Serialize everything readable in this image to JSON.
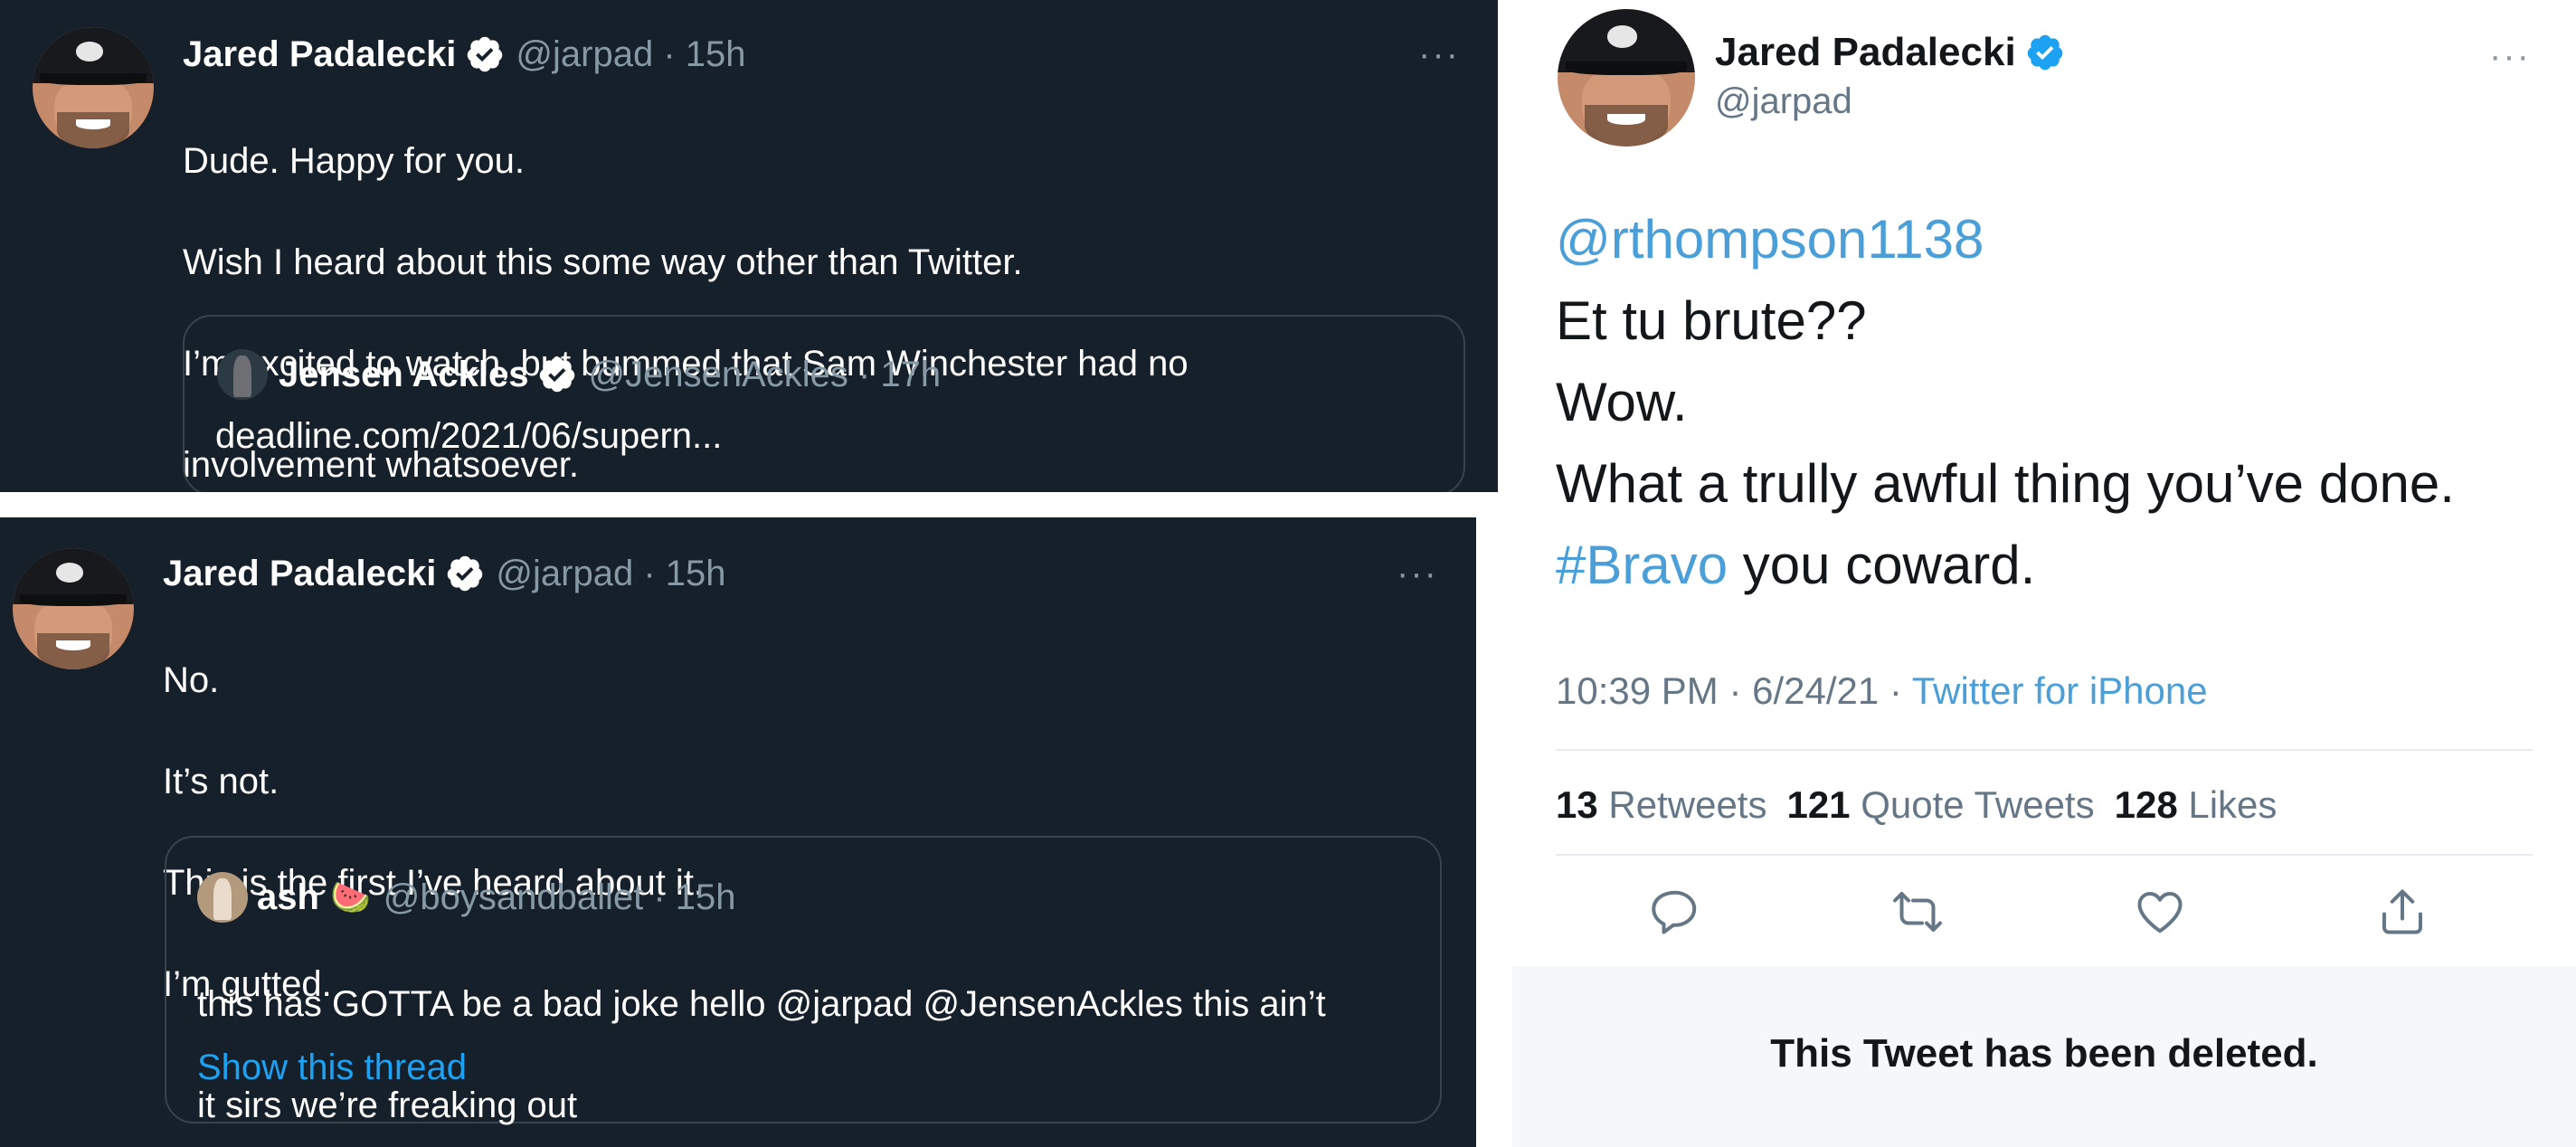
{
  "tweet1": {
    "name": "Jared Padalecki",
    "meta": "@jarpad · 15h",
    "more": "···",
    "lines": [
      "Dude. Happy for you.",
      "Wish I heard about this some way other than Twitter.",
      "I’m excited to watch, but bummed that Sam Winchester had no",
      "involvement whatsoever."
    ],
    "quote": {
      "name": "Jensen Ackles",
      "meta": "@JensenAckles · 17h",
      "text": "deadline.com/2021/06/supern..."
    }
  },
  "tweet2": {
    "name": "Jared Padalecki",
    "meta": "@jarpad · 15h",
    "more": "···",
    "lines": [
      "No.",
      "It’s not.",
      "This is the first I’ve heard about it.",
      "I’m gutted."
    ],
    "quote": {
      "name": "ash",
      "emoji": "🍉",
      "meta": "@boysandballet · 15h",
      "line1": "this has GOTTA be a bad joke hello @jarpad @JensenAckles this ain’t",
      "line2": "it sirs we’re freaking out",
      "show_thread": "Show this thread"
    }
  },
  "tweet3": {
    "name": "Jared Padalecki",
    "handle": "@jarpad",
    "more": "···",
    "mention": "@rthompson1138",
    "line1": "Et tu brute??",
    "line2": "Wow.",
    "line3": "What a trully awful thing you’ve done.",
    "hashtag": "#Bravo",
    "line4_rest": " you coward.",
    "time": "10:39 PM · 6/24/21 · ",
    "source": "Twitter for iPhone",
    "retweets": "13",
    "retweets_label": "Retweets",
    "quotes": "121",
    "quotes_label": "Quote Tweets",
    "likes": "128",
    "likes_label": "Likes",
    "deleted": "This Tweet has been deleted."
  },
  "colors": {
    "dark_bg": "#15202b",
    "link": "#1da1f2",
    "muted": "#8899a6"
  },
  "icons": [
    "verified-badge-icon",
    "more-icon",
    "reply-icon",
    "retweet-icon",
    "like-icon",
    "share-icon"
  ]
}
